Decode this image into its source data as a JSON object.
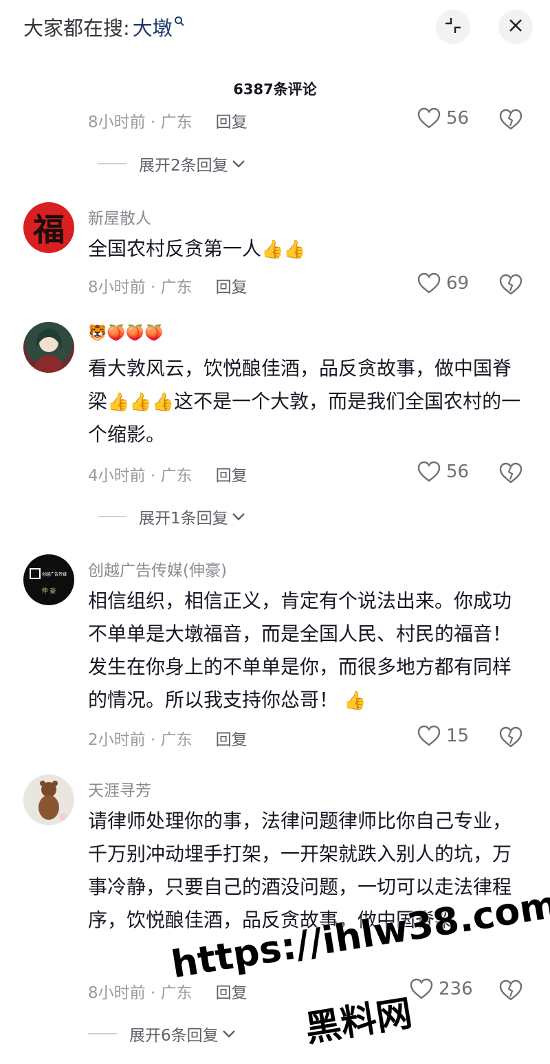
{
  "header": {
    "search_hint_label": "大家都在搜:",
    "search_term": "大墩",
    "comment_count": "6387条评论"
  },
  "icons": {
    "collapse": "collapse-icon",
    "close": "close-icon",
    "like": "heart-outline-icon",
    "dislike": "broken-heart-icon",
    "thumbs_up": "👍"
  },
  "reply_label": "回复",
  "top_partial": {
    "time_location": "8小时前 · 广东",
    "likes": "56",
    "expand": "展开2条回复"
  },
  "comments": [
    {
      "username": "新屋散人",
      "avatar_char": "福",
      "text": "全国农村反贪第一人",
      "time_location": "8小时前 · 广东",
      "likes": "69"
    },
    {
      "username": "🐯🍑🍑🍑",
      "text_1": "看大敦风云，饮悦酿佳酒，品反贪故事，做中国脊梁",
      "text_2": "这不是一个大敦，而是我们全国农村的一个缩影。",
      "time_location": "4小时前 · 广东",
      "likes": "56",
      "expand": "展开1条回复"
    },
    {
      "username": "创越广告传媒(伸豪)",
      "avatar_text_top": "创越广告传媒",
      "avatar_text_bottom": "伸 豪",
      "text": "相信组织，相信正义，肯定有个说法出来。你成功不单单是大墩福音，而是全国人民、村民的福音！发生在你身上的不单单是你，而很多地方都有同样的情况。所以我支持你怂哥！",
      "time_location": "2小时前 · 广东",
      "likes": "15"
    },
    {
      "username": "天涯寻芳",
      "text": "请律师处理你的事，法律问题律师比你自己专业，千万别冲动埋手打架，一开架就跌入别人的坑，万事冷静，只要自己的酒没问题，一切可以走法律程序，饮悦酿佳酒，品反贪故事，做中国脊梁",
      "time_location": "8小时前 · 广东",
      "likes": "236",
      "expand": "展开6条回复"
    }
  ],
  "watermark": {
    "url": "https://ihlw38.com",
    "name": "黑料网"
  },
  "colors": {
    "text": "#161823",
    "muted": "#9a9ba1",
    "link": "#1f3a6b",
    "background": "#ffffff"
  }
}
